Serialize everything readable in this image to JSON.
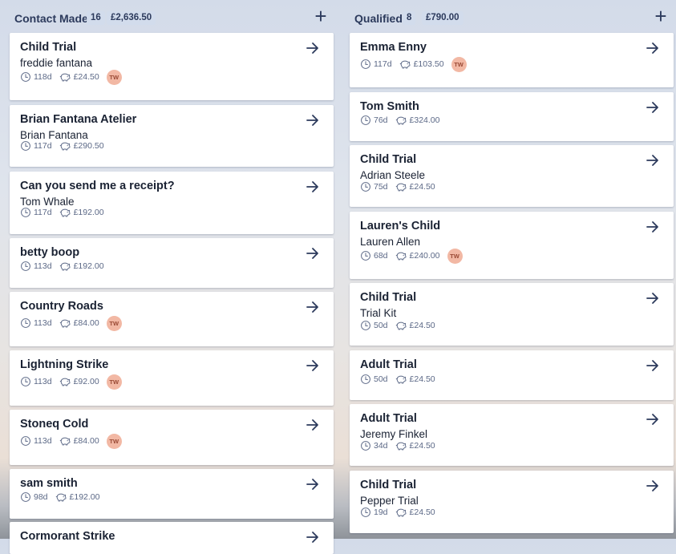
{
  "columns": [
    {
      "title": "Contact Made",
      "count": "16",
      "total": "£2,636.50",
      "cards": [
        {
          "title": "Child Trial",
          "subtitle": "freddie fantana",
          "days": "118d",
          "value": "£24.50",
          "badge": "TW"
        },
        {
          "title": "Brian Fantana Atelier",
          "subtitle": "Brian Fantana",
          "days": "117d",
          "value": "£290.50",
          "badge": ""
        },
        {
          "title": "Can you send me a receipt?",
          "subtitle": "Tom Whale",
          "days": "117d",
          "value": "£192.00",
          "badge": ""
        },
        {
          "title": "betty boop",
          "subtitle": "",
          "days": "113d",
          "value": "£192.00",
          "badge": ""
        },
        {
          "title": "Country Roads",
          "subtitle": "",
          "days": "113d",
          "value": "£84.00",
          "badge": "TW"
        },
        {
          "title": "Lightning Strike",
          "subtitle": "",
          "days": "113d",
          "value": "£92.00",
          "badge": "TW"
        },
        {
          "title": "Stoneq Cold",
          "subtitle": "",
          "days": "113d",
          "value": "£84.00",
          "badge": "TW"
        },
        {
          "title": "sam smith",
          "subtitle": "",
          "days": "98d",
          "value": "£192.00",
          "badge": ""
        },
        {
          "title": "Cormorant Strike",
          "subtitle": "",
          "days": "",
          "value": "",
          "badge": ""
        }
      ]
    },
    {
      "title": "Qualified",
      "count": "8",
      "total": "£790.00",
      "cards": [
        {
          "title": "Emma Enny",
          "subtitle": "",
          "days": "117d",
          "value": "£103.50",
          "badge": "TW"
        },
        {
          "title": "Tom Smith",
          "subtitle": "",
          "days": "76d",
          "value": "£324.00",
          "badge": ""
        },
        {
          "title": "Child Trial",
          "subtitle": "Adrian Steele",
          "days": "75d",
          "value": "£24.50",
          "badge": ""
        },
        {
          "title": "Lauren's Child",
          "subtitle": "Lauren Allen",
          "days": "68d",
          "value": "£240.00",
          "badge": "TW"
        },
        {
          "title": "Child Trial",
          "subtitle": "Trial Kit",
          "days": "50d",
          "value": "£24.50",
          "badge": ""
        },
        {
          "title": "Adult Trial",
          "subtitle": "",
          "days": "50d",
          "value": "£24.50",
          "badge": ""
        },
        {
          "title": "Adult Trial",
          "subtitle": "Jeremy Finkel",
          "days": "34d",
          "value": "£24.50",
          "badge": ""
        },
        {
          "title": "Child Trial",
          "subtitle": "Pepper Trial",
          "days": "19d",
          "value": "£24.50",
          "badge": ""
        }
      ]
    }
  ],
  "icons": {
    "add": "plus-icon",
    "open": "arrow-right-icon",
    "age": "clock-icon",
    "value": "piggy-bank-icon"
  },
  "colors": {
    "text": "#1a2233",
    "accent": "#2c3a5c",
    "badge_bg": "#f2b8a4"
  }
}
